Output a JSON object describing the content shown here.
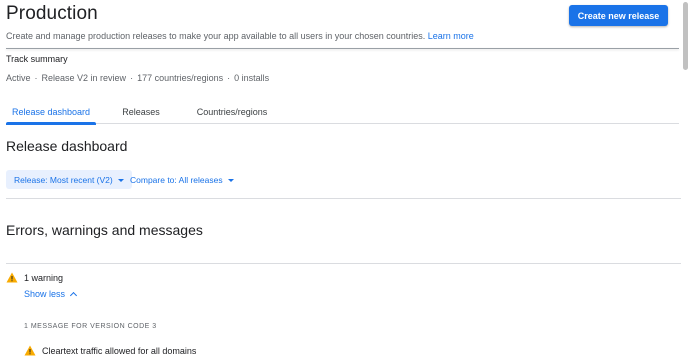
{
  "header": {
    "title": "Production",
    "subtitle": "Create and manage production releases to make your app available to all users in your chosen countries.",
    "learn_more": "Learn more",
    "primary_button": "Create new release"
  },
  "summary": {
    "heading": "Track summary",
    "status": "Active",
    "release": "Release V2 in review",
    "countries": "177 countries/regions",
    "installs": "0 installs",
    "separator": "·"
  },
  "tabs": [
    {
      "label": "Release dashboard",
      "active": true
    },
    {
      "label": "Releases",
      "active": false
    },
    {
      "label": "Countries/regions",
      "active": false
    }
  ],
  "dashboard": {
    "title": "Release dashboard",
    "release_filter": "Release: Most recent (V2)",
    "compare_filter": "Compare to: All releases"
  },
  "messages": {
    "title": "Errors, warnings and messages",
    "warning_count": "1 warning",
    "toggle_label": "Show less",
    "group_header": "1 MESSAGE FOR VERSION CODE 3",
    "items": [
      {
        "text": "Cleartext traffic allowed for all domains",
        "severity": "warning"
      }
    ]
  },
  "colors": {
    "accent": "#1a73e8",
    "warning": "#f9ab00",
    "chip_bg": "#e8f0fe"
  },
  "icons": {
    "warning": "warning-triangle-icon",
    "dropdown": "caret-down-icon",
    "collapse": "chevron-up-icon"
  }
}
